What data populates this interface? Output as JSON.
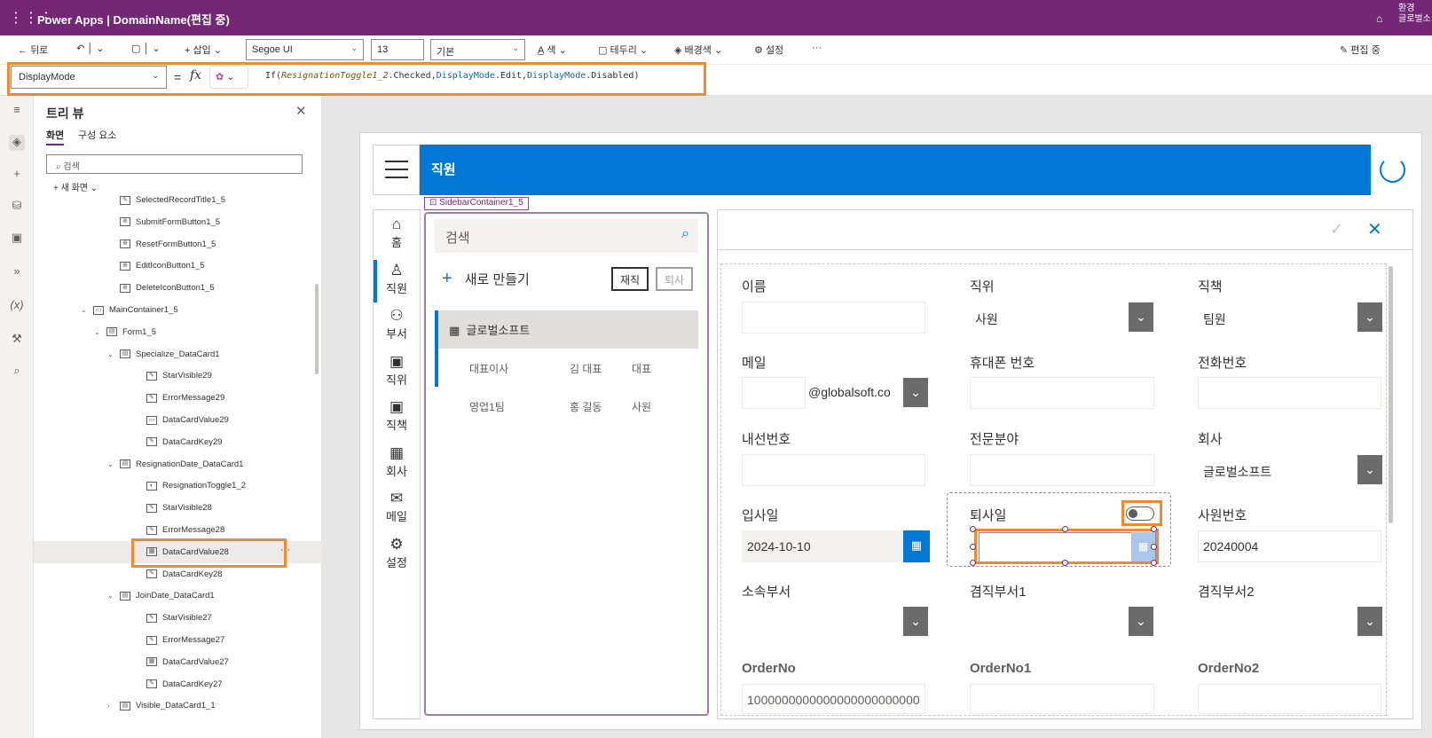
{
  "topbar": {
    "app_name": "Power Apps",
    "separator": "|",
    "doc_title": "DomainName(편집 중)",
    "env_label": "환경",
    "env_value": "글로벌소"
  },
  "cmdbar": {
    "back": "뒤로",
    "insert": "삽입",
    "font": "Segoe UI",
    "font_size": "13",
    "weight": "기본",
    "color": "색",
    "border": "테두리",
    "fill": "배경색",
    "settings": "설정",
    "more": "···",
    "editing": "편집 중"
  },
  "formulabar": {
    "property": "DisplayMode",
    "equals": "=",
    "fx": "fx",
    "f_if": "If(",
    "f_control": "ResignationToggle1_2",
    "f_checked": ".Checked,",
    "f_dm1": "DisplayMode",
    "f_edit": ".Edit,",
    "f_dm2": "DisplayMode",
    "f_disabled": ".Disabled)"
  },
  "tree": {
    "title": "트리 뷰",
    "tab_screens": "화면",
    "tab_components": "구성 요소",
    "search_placeholder": "검색",
    "new_screen": "새 화면",
    "nodes": [
      {
        "label": "SelectedRecordTitle1_5",
        "icon": "edit-icon"
      },
      {
        "label": "SubmitFormButton1_5",
        "icon": "button-icon"
      },
      {
        "label": "ResetFormButton1_5",
        "icon": "button-icon"
      },
      {
        "label": "EditIconButton1_5",
        "icon": "button-icon"
      },
      {
        "label": "DeleteIconButton1_5",
        "icon": "button-icon"
      },
      {
        "label": "MainContainer1_5",
        "icon": "container-icon"
      },
      {
        "label": "Form1_5",
        "icon": "form-icon"
      },
      {
        "label": "Specialize_DataCard1",
        "icon": "card-icon"
      },
      {
        "label": "StarVisible29",
        "icon": "edit-icon"
      },
      {
        "label": "ErrorMessage29",
        "icon": "edit-icon"
      },
      {
        "label": "DataCardValue29",
        "icon": "input-icon"
      },
      {
        "label": "DataCardKey29",
        "icon": "edit-icon"
      },
      {
        "label": "ResignationDate_DataCard1",
        "icon": "card-icon"
      },
      {
        "label": "ResignationToggle1_2",
        "icon": "toggle-icon"
      },
      {
        "label": "StarVisible28",
        "icon": "edit-icon"
      },
      {
        "label": "ErrorMessage28",
        "icon": "edit-icon"
      },
      {
        "label": "DataCardValue28",
        "icon": "calendar-icon"
      },
      {
        "label": "DataCardKey28",
        "icon": "edit-icon"
      },
      {
        "label": "JoinDate_DataCard1",
        "icon": "card-icon"
      },
      {
        "label": "StarVisible27",
        "icon": "edit-icon"
      },
      {
        "label": "ErrorMessage27",
        "icon": "edit-icon"
      },
      {
        "label": "DataCardValue27",
        "icon": "calendar-icon"
      },
      {
        "label": "DataCardKey27",
        "icon": "edit-icon"
      },
      {
        "label": "Visible_DataCard1_1",
        "icon": "card-icon"
      }
    ],
    "selected_more": "···"
  },
  "app": {
    "header_title": "직원",
    "container_label": "SidebarContainer1_5",
    "sidebar": [
      {
        "label": "홈",
        "icon": "home-icon"
      },
      {
        "label": "직원",
        "icon": "person-icon"
      },
      {
        "label": "부서",
        "icon": "people-icon"
      },
      {
        "label": "직위",
        "icon": "badge-icon"
      },
      {
        "label": "직책",
        "icon": "badge-icon"
      },
      {
        "label": "회사",
        "icon": "building-icon"
      },
      {
        "label": "메일",
        "icon": "mail-icon"
      },
      {
        "label": "설정",
        "icon": "gear-icon"
      }
    ],
    "list": {
      "search_placeholder": "검색",
      "new_label": "새로 만들기",
      "toggle_active": "재직",
      "toggle_resigned": "퇴사",
      "group": "글로벌소프트",
      "rows": [
        {
          "dept": "대표이사",
          "name": "김 대표",
          "title": "대표"
        },
        {
          "dept": "영업1팀",
          "name": "홍 길동",
          "title": "사원"
        }
      ]
    },
    "form": {
      "name_label": "이름",
      "position_label": "직위",
      "position_value": "사원",
      "duty_label": "직책",
      "duty_value": "팀원",
      "email_label": "메일",
      "email_domain": "@globalsoft.co",
      "mobile_label": "휴대폰 번호",
      "phone_label": "전화번호",
      "ext_label": "내선번호",
      "specialty_label": "전문분야",
      "company_label": "회사",
      "company_value": "글로벌소프트",
      "join_label": "입사일",
      "join_value": "2024-10-10",
      "resign_label": "퇴사일",
      "empno_label": "사원번호",
      "empno_value": "20240004",
      "dept_label": "소속부서",
      "dept2_label": "겸직부서1",
      "dept3_label": "겸직부서2",
      "order_label": "OrderNo",
      "order_value": "1000000000000000000000000",
      "order1_label": "OrderNo1",
      "order2_label": "OrderNo2"
    }
  },
  "colors": {
    "brand": "#742774",
    "accent": "#0078d4",
    "highlight": "#f08a2c"
  }
}
